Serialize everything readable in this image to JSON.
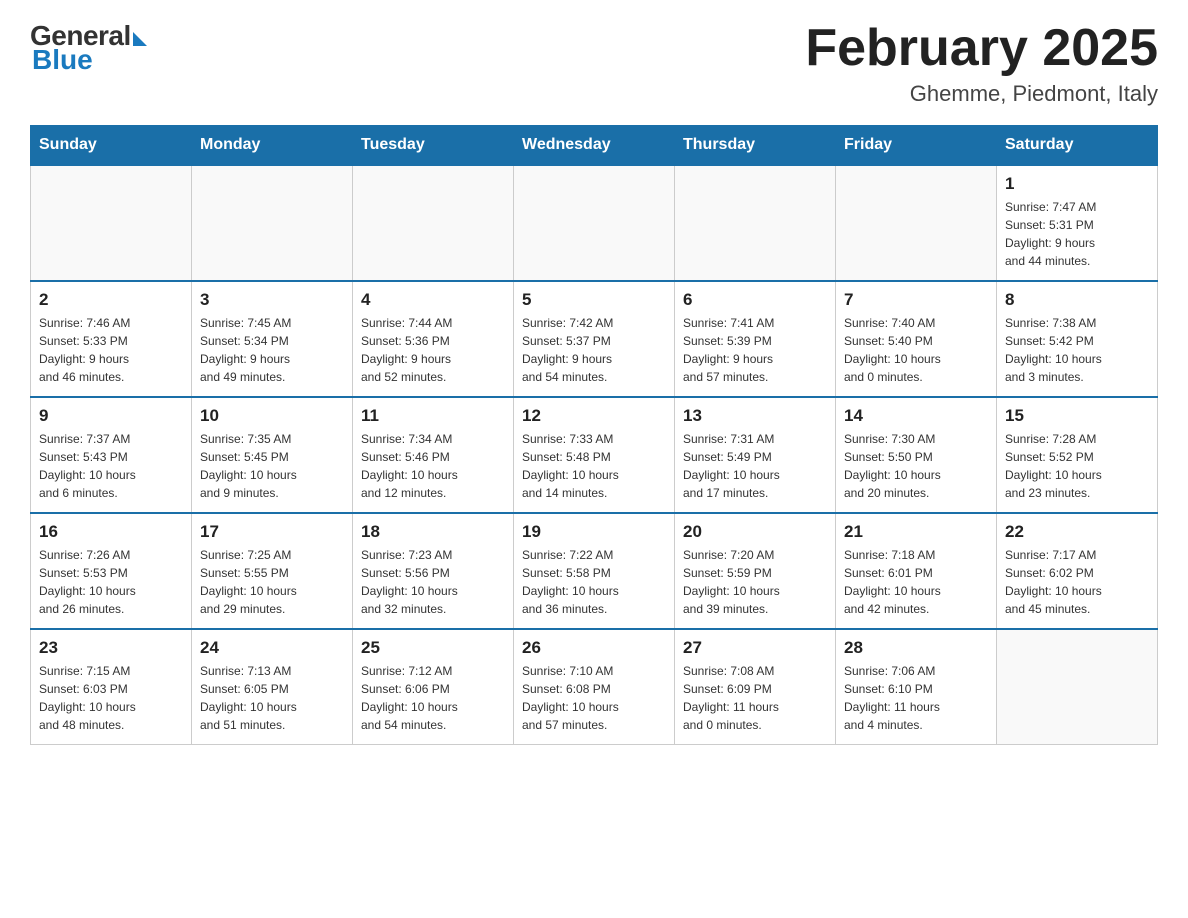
{
  "logo": {
    "general": "General",
    "blue": "Blue"
  },
  "title": "February 2025",
  "subtitle": "Ghemme, Piedmont, Italy",
  "days_of_week": [
    "Sunday",
    "Monday",
    "Tuesday",
    "Wednesday",
    "Thursday",
    "Friday",
    "Saturday"
  ],
  "weeks": [
    [
      {
        "day": "",
        "info": ""
      },
      {
        "day": "",
        "info": ""
      },
      {
        "day": "",
        "info": ""
      },
      {
        "day": "",
        "info": ""
      },
      {
        "day": "",
        "info": ""
      },
      {
        "day": "",
        "info": ""
      },
      {
        "day": "1",
        "info": "Sunrise: 7:47 AM\nSunset: 5:31 PM\nDaylight: 9 hours\nand 44 minutes."
      }
    ],
    [
      {
        "day": "2",
        "info": "Sunrise: 7:46 AM\nSunset: 5:33 PM\nDaylight: 9 hours\nand 46 minutes."
      },
      {
        "day": "3",
        "info": "Sunrise: 7:45 AM\nSunset: 5:34 PM\nDaylight: 9 hours\nand 49 minutes."
      },
      {
        "day": "4",
        "info": "Sunrise: 7:44 AM\nSunset: 5:36 PM\nDaylight: 9 hours\nand 52 minutes."
      },
      {
        "day": "5",
        "info": "Sunrise: 7:42 AM\nSunset: 5:37 PM\nDaylight: 9 hours\nand 54 minutes."
      },
      {
        "day": "6",
        "info": "Sunrise: 7:41 AM\nSunset: 5:39 PM\nDaylight: 9 hours\nand 57 minutes."
      },
      {
        "day": "7",
        "info": "Sunrise: 7:40 AM\nSunset: 5:40 PM\nDaylight: 10 hours\nand 0 minutes."
      },
      {
        "day": "8",
        "info": "Sunrise: 7:38 AM\nSunset: 5:42 PM\nDaylight: 10 hours\nand 3 minutes."
      }
    ],
    [
      {
        "day": "9",
        "info": "Sunrise: 7:37 AM\nSunset: 5:43 PM\nDaylight: 10 hours\nand 6 minutes."
      },
      {
        "day": "10",
        "info": "Sunrise: 7:35 AM\nSunset: 5:45 PM\nDaylight: 10 hours\nand 9 minutes."
      },
      {
        "day": "11",
        "info": "Sunrise: 7:34 AM\nSunset: 5:46 PM\nDaylight: 10 hours\nand 12 minutes."
      },
      {
        "day": "12",
        "info": "Sunrise: 7:33 AM\nSunset: 5:48 PM\nDaylight: 10 hours\nand 14 minutes."
      },
      {
        "day": "13",
        "info": "Sunrise: 7:31 AM\nSunset: 5:49 PM\nDaylight: 10 hours\nand 17 minutes."
      },
      {
        "day": "14",
        "info": "Sunrise: 7:30 AM\nSunset: 5:50 PM\nDaylight: 10 hours\nand 20 minutes."
      },
      {
        "day": "15",
        "info": "Sunrise: 7:28 AM\nSunset: 5:52 PM\nDaylight: 10 hours\nand 23 minutes."
      }
    ],
    [
      {
        "day": "16",
        "info": "Sunrise: 7:26 AM\nSunset: 5:53 PM\nDaylight: 10 hours\nand 26 minutes."
      },
      {
        "day": "17",
        "info": "Sunrise: 7:25 AM\nSunset: 5:55 PM\nDaylight: 10 hours\nand 29 minutes."
      },
      {
        "day": "18",
        "info": "Sunrise: 7:23 AM\nSunset: 5:56 PM\nDaylight: 10 hours\nand 32 minutes."
      },
      {
        "day": "19",
        "info": "Sunrise: 7:22 AM\nSunset: 5:58 PM\nDaylight: 10 hours\nand 36 minutes."
      },
      {
        "day": "20",
        "info": "Sunrise: 7:20 AM\nSunset: 5:59 PM\nDaylight: 10 hours\nand 39 minutes."
      },
      {
        "day": "21",
        "info": "Sunrise: 7:18 AM\nSunset: 6:01 PM\nDaylight: 10 hours\nand 42 minutes."
      },
      {
        "day": "22",
        "info": "Sunrise: 7:17 AM\nSunset: 6:02 PM\nDaylight: 10 hours\nand 45 minutes."
      }
    ],
    [
      {
        "day": "23",
        "info": "Sunrise: 7:15 AM\nSunset: 6:03 PM\nDaylight: 10 hours\nand 48 minutes."
      },
      {
        "day": "24",
        "info": "Sunrise: 7:13 AM\nSunset: 6:05 PM\nDaylight: 10 hours\nand 51 minutes."
      },
      {
        "day": "25",
        "info": "Sunrise: 7:12 AM\nSunset: 6:06 PM\nDaylight: 10 hours\nand 54 minutes."
      },
      {
        "day": "26",
        "info": "Sunrise: 7:10 AM\nSunset: 6:08 PM\nDaylight: 10 hours\nand 57 minutes."
      },
      {
        "day": "27",
        "info": "Sunrise: 7:08 AM\nSunset: 6:09 PM\nDaylight: 11 hours\nand 0 minutes."
      },
      {
        "day": "28",
        "info": "Sunrise: 7:06 AM\nSunset: 6:10 PM\nDaylight: 11 hours\nand 4 minutes."
      },
      {
        "day": "",
        "info": ""
      }
    ]
  ]
}
